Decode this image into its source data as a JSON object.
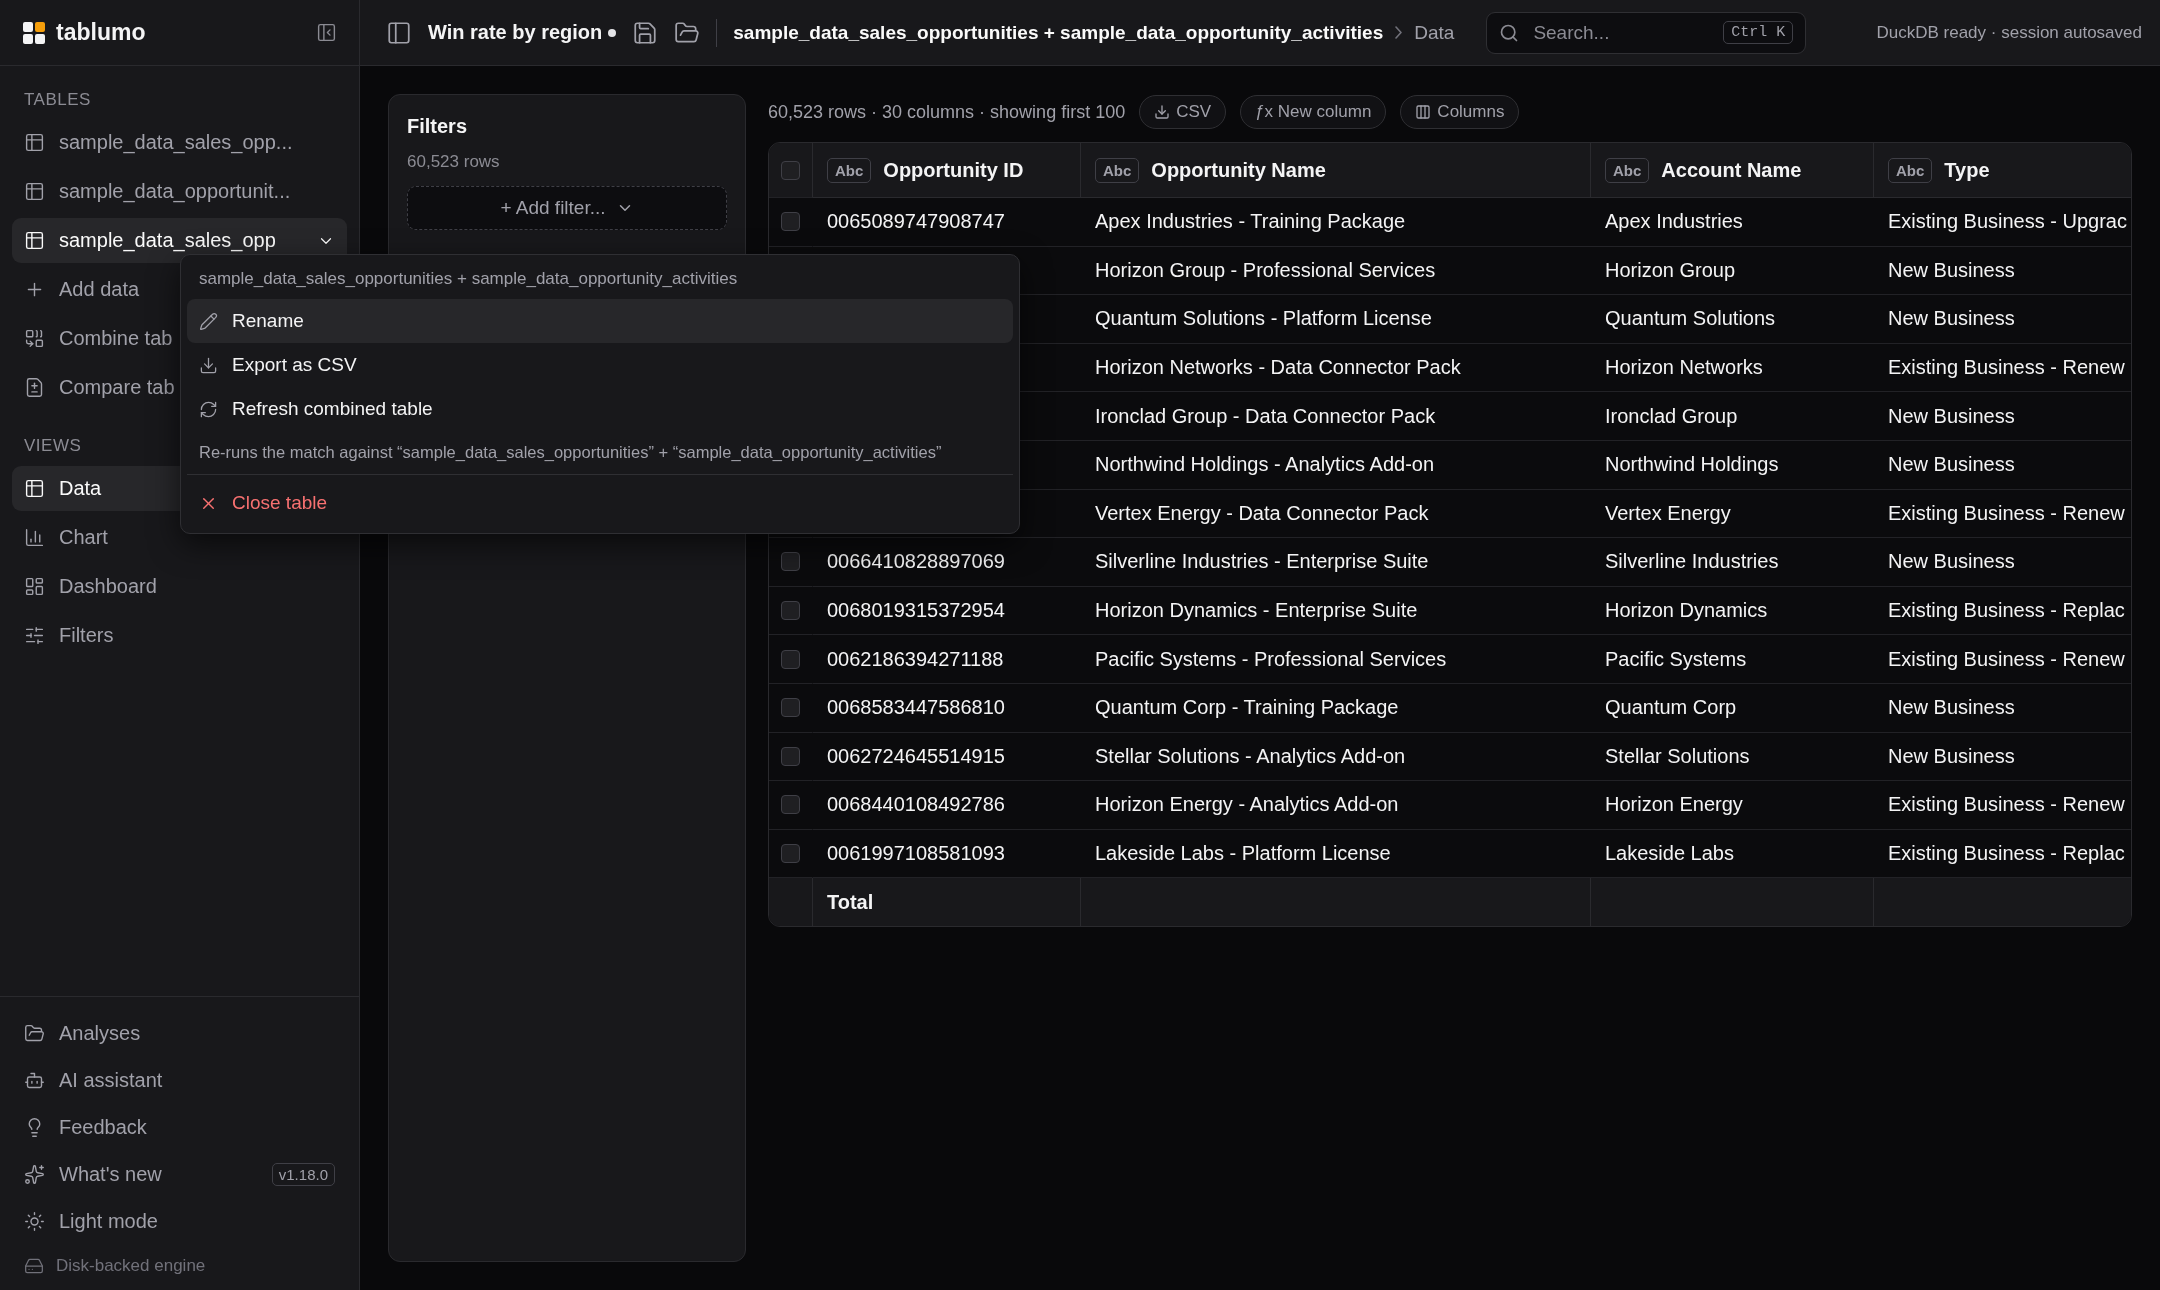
{
  "brand": "tablumo",
  "sidebar": {
    "tables_heading": "TABLES",
    "tables": [
      {
        "label": "sample_data_sales_opp...",
        "kind": "table",
        "selected": false
      },
      {
        "label": "sample_data_opportunit...",
        "kind": "table",
        "selected": false
      },
      {
        "label": "sample_data_sales_opp",
        "kind": "table",
        "selected": true,
        "menu_open": true
      },
      {
        "label": "Add data",
        "kind": "action",
        "selected": false
      },
      {
        "label": "Combine tab",
        "kind": "action",
        "selected": false
      },
      {
        "label": "Compare tab",
        "kind": "action",
        "selected": false
      }
    ],
    "views_heading": "VIEWS",
    "views": [
      {
        "label": "Data",
        "selected": true
      },
      {
        "label": "Chart",
        "selected": false
      },
      {
        "label": "Dashboard",
        "selected": false
      },
      {
        "label": "Filters",
        "selected": false
      }
    ],
    "footer": [
      {
        "label": "Analyses"
      },
      {
        "label": "AI assistant"
      },
      {
        "label": "Feedback"
      },
      {
        "label": "What's new",
        "badge": "v1.18.0"
      },
      {
        "label": "Light mode"
      }
    ],
    "engine": "Disk-backed engine"
  },
  "topbar": {
    "title": "Win rate by region",
    "unsaved": true,
    "breadcrumb": [
      "sample_data_sales_opportunities + sample_data_opportunity_activities",
      "Data"
    ],
    "search": {
      "placeholder": "Search...",
      "shortcut": "Ctrl K"
    },
    "status": "DuckDB ready · session autosaved"
  },
  "filters": {
    "title": "Filters",
    "count": "60,523 rows",
    "add": "+ Add filter..."
  },
  "toolbar": {
    "summary": "60,523 rows · 30 columns · showing first 100",
    "buttons": [
      "CSV",
      "ƒx New column",
      "Columns"
    ]
  },
  "table": {
    "header_checked": false,
    "columns": [
      {
        "badge": "Abc",
        "label": "Opportunity ID"
      },
      {
        "badge": "Abc",
        "label": "Opportunity Name"
      },
      {
        "badge": "Abc",
        "label": "Account Name"
      },
      {
        "badge": "Abc",
        "label": "Type"
      }
    ],
    "rows": [
      {
        "checked": false,
        "cells": [
          "0065089747908747",
          "Apex Industries - Training Package",
          "Apex Industries",
          "Existing Business - Upgrac"
        ]
      },
      {
        "cells": [
          "",
          "Horizon Group - Professional Services",
          "Horizon Group",
          "New Business"
        ]
      },
      {
        "cells": [
          "",
          "Quantum Solutions - Platform License",
          "Quantum Solutions",
          "New Business"
        ]
      },
      {
        "cells": [
          "",
          "Horizon Networks - Data Connector Pack",
          "Horizon Networks",
          "Existing Business - Renew"
        ]
      },
      {
        "cells": [
          "",
          "Ironclad Group - Data Connector Pack",
          "Ironclad Group",
          "New Business"
        ]
      },
      {
        "cells": [
          "",
          "Northwind Holdings - Analytics Add-on",
          "Northwind Holdings",
          "New Business"
        ]
      },
      {
        "cells": [
          "",
          "Vertex Energy - Data Connector Pack",
          "Vertex Energy",
          "Existing Business - Renew"
        ]
      },
      {
        "checked": false,
        "cells": [
          "0066410828897069",
          "Silverline Industries - Enterprise Suite",
          "Silverline Industries",
          "New Business"
        ]
      },
      {
        "checked": false,
        "cells": [
          "0068019315372954",
          "Horizon Dynamics - Enterprise Suite",
          "Horizon Dynamics",
          "Existing Business - Replac"
        ]
      },
      {
        "checked": false,
        "cells": [
          "0062186394271188",
          "Pacific Systems - Professional Services",
          "Pacific Systems",
          "Existing Business - Renew"
        ]
      },
      {
        "checked": false,
        "cells": [
          "0068583447586810",
          "Quantum Corp - Training Package",
          "Quantum Corp",
          "New Business"
        ]
      },
      {
        "checked": false,
        "cells": [
          "0062724645514915",
          "Stellar Solutions - Analytics Add-on",
          "Stellar Solutions",
          "New Business"
        ]
      },
      {
        "checked": false,
        "cells": [
          "0068440108492786",
          "Horizon Energy - Analytics Add-on",
          "Horizon Energy",
          "Existing Business - Renew"
        ]
      },
      {
        "checked": false,
        "cells": [
          "0061997108581093",
          "Lakeside Labs - Platform License",
          "Lakeside Labs",
          "Existing Business - Replac"
        ]
      }
    ],
    "total": "Total"
  },
  "context_menu": {
    "title": "sample_data_sales_opportunities + sample_data_opportunity_activities",
    "items": [
      {
        "kind": "action",
        "label": "Rename",
        "selected": true
      },
      {
        "kind": "action",
        "label": "Export as CSV",
        "selected": false
      },
      {
        "kind": "action",
        "label": "Refresh combined table",
        "selected": false
      },
      {
        "kind": "note",
        "label": "Re-runs the match against “sample_data_sales_opportunities” + “sample_data_opportunity_activities”"
      },
      {
        "kind": "danger",
        "label": "Close table",
        "selected": false
      }
    ]
  }
}
